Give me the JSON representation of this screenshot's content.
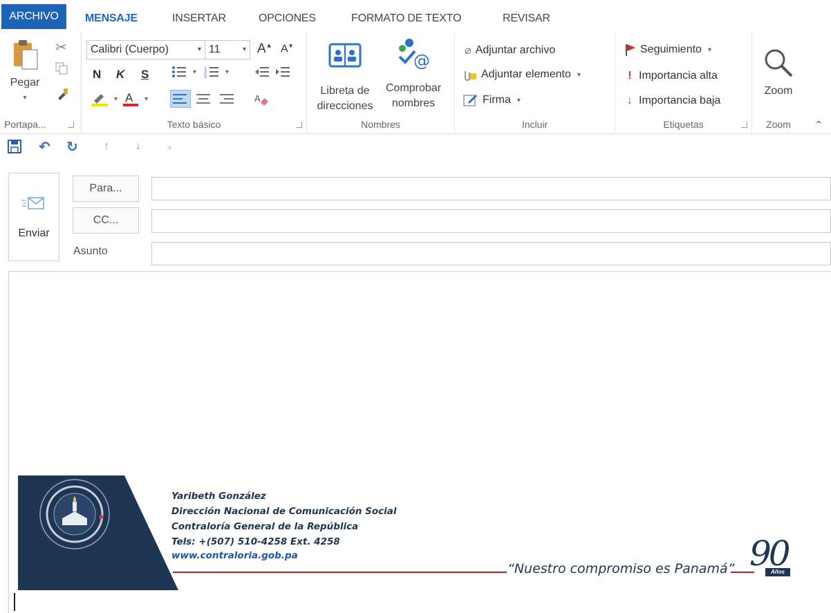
{
  "tabs": {
    "file": "ARCHIVO",
    "message": "MENSAJE",
    "insert": "INSERTAR",
    "options": "OPCIONES",
    "format_text": "FORMATO DE TEXTO",
    "review": "REVISAR"
  },
  "ribbon": {
    "clipboard": {
      "paste_label": "Pegar",
      "group_label": "Portapa..."
    },
    "basic_text": {
      "font_name": "Calibri (Cuerpo)",
      "font_size": "11",
      "grow_glyph": "A",
      "shrink_glyph": "A",
      "bold": "N",
      "italic": "K",
      "underline": "S",
      "group_label": "Texto básico"
    },
    "names": {
      "address_book_line1": "Libreta de",
      "address_book_line2": "direcciones",
      "check_names_line1": "Comprobar",
      "check_names_line2": "nombres",
      "group_label": "Nombres"
    },
    "include": {
      "attach_file": "Adjuntar archivo",
      "attach_item": "Adjuntar elemento",
      "signature": "Firma",
      "group_label": "Incluir"
    },
    "tags": {
      "follow_up": "Seguimiento",
      "high_importance": "Importancia alta",
      "low_importance": "Importancia baja",
      "group_label": "Etiquetas"
    },
    "zoom": {
      "zoom_label": "Zoom",
      "group_label": "Zoom"
    }
  },
  "compose": {
    "send_label": "Enviar",
    "to_label": "Para...",
    "cc_label": "CC...",
    "subject_label": "Asunto",
    "to_value": "",
    "cc_value": "",
    "subject_value": ""
  },
  "signature": {
    "name": "Yaribeth González",
    "department": "Dirección Nacional de Comunicación Social",
    "organization": "Contraloría General de la República",
    "phone": "Tels: +(507) 510-4258  Ext. 4258",
    "website": "www.contraloria.gob.pa",
    "motto": "“Nuestro compromiso es Panamá”",
    "anniversary_number": "90",
    "anniversary_word": "Años"
  },
  "colors": {
    "accent": "#2166bd",
    "file_tab": "#1f63b8",
    "signature_navy": "#1e3554",
    "signature_red": "#b62024"
  }
}
